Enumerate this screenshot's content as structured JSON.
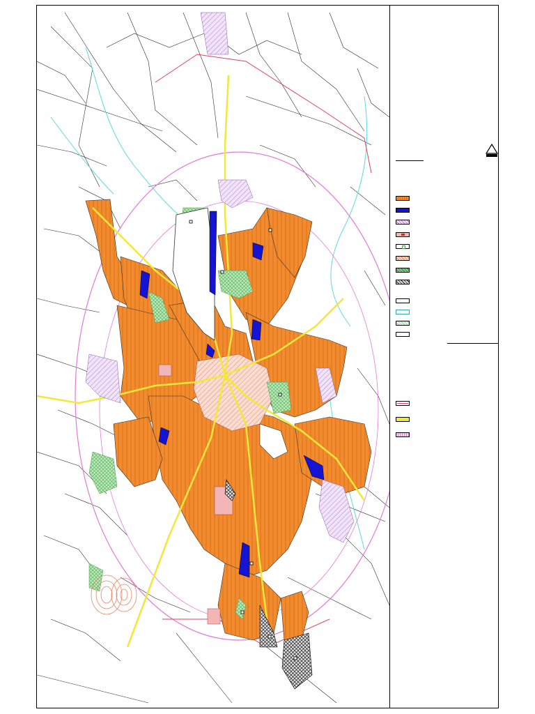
{
  "map": {
    "colors": {
      "paper": "#ffffff",
      "frame": "#000000",
      "parcel_line": "#2a2a2a",
      "residential": "#f28a2e",
      "residential_hatch": "#d8731c",
      "industrial": "#1414d2",
      "service": "#c9a3e6",
      "green": "#a8e0a8",
      "historic_center": "#e8a0a0",
      "commercial": "#f4b8a0",
      "agricultural_special": "#a0a0a0",
      "main_road": "#f2e83a",
      "boundary_ring": "#e37ad9",
      "district_boundary": "#e04060",
      "stream": "#5fd8e0",
      "green_corridor": "#8fd88f"
    },
    "legend": {
      "north_arrow_icon": "north-arrow-icon",
      "zones": [
        {
          "id": "residential",
          "fill": "#f28a2e",
          "pattern": "hatch"
        },
        {
          "id": "industrial",
          "fill": "#1414d2",
          "pattern": "solid"
        },
        {
          "id": "services",
          "fill": "#e9d4f5",
          "pattern": "hatch"
        },
        {
          "id": "historic",
          "fill": "#f3b6b6",
          "pattern": "symbol"
        },
        {
          "id": "public-facility",
          "fill": "#ffffff",
          "pattern": "green-square"
        },
        {
          "id": "commercial",
          "fill": "#fbd3c0",
          "pattern": "hatch"
        },
        {
          "id": "green-park",
          "fill": "#7ed07e",
          "pattern": "cross"
        },
        {
          "id": "special",
          "fill": "#bdbdbd",
          "pattern": "crosshatch"
        }
      ],
      "lines_group": [
        {
          "id": "agricultural",
          "fill": "#ffffff",
          "pattern": "solid"
        },
        {
          "id": "water",
          "fill": "#ffffff",
          "pattern": "cyan-border"
        },
        {
          "id": "green-buffer",
          "fill": "#d9f2d9",
          "pattern": "hatch"
        },
        {
          "id": "other",
          "fill": "#ffffff",
          "pattern": "solid"
        }
      ],
      "infrastructure": [
        {
          "id": "district-boundary",
          "fill": "#ffffff",
          "pattern": "red-line"
        },
        {
          "id": "main-road",
          "fill": "#f2e83a",
          "pattern": "solid"
        },
        {
          "id": "urban-limit",
          "fill": "#e37ad9",
          "pattern": "hatch"
        }
      ]
    }
  }
}
